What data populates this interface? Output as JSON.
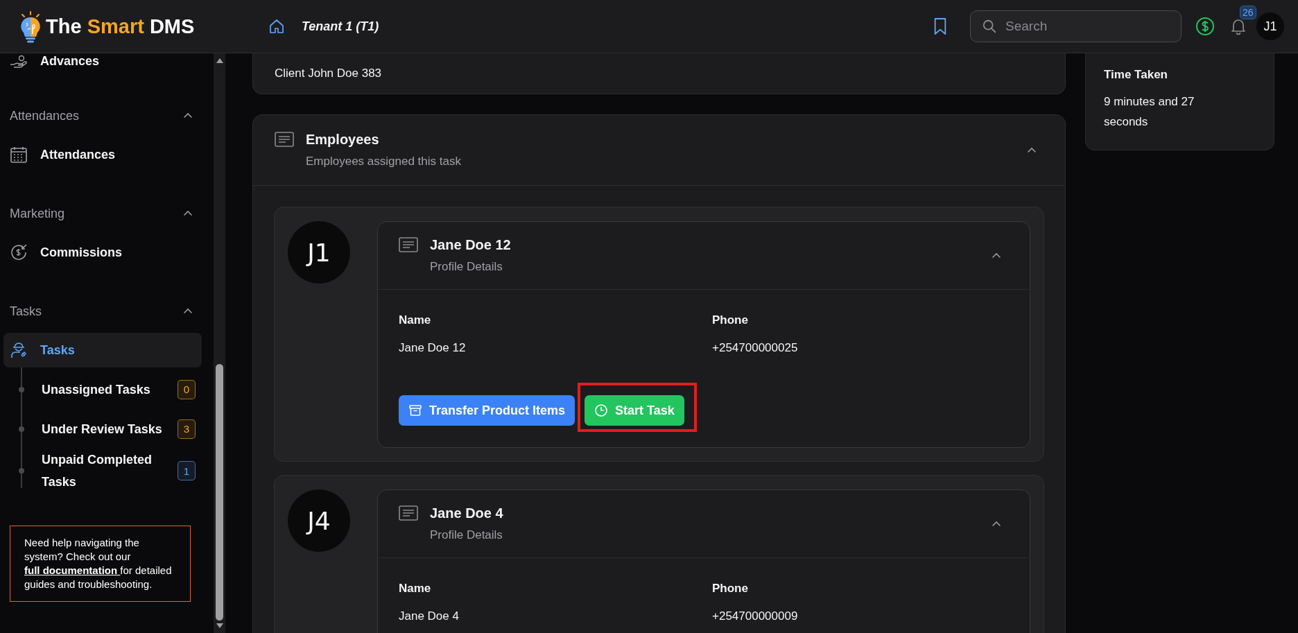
{
  "header": {
    "logo": [
      {
        "text": "The",
        "accent": false
      },
      {
        "text": "Smart",
        "accent": true
      },
      {
        "text": "DMS",
        "accent": false
      }
    ],
    "tenant": "Tenant 1 (T1)",
    "search": {
      "placeholder": "Search"
    },
    "notification_count": "26",
    "avatar": "J1"
  },
  "sidebar": {
    "top_item": {
      "label": "Advances"
    },
    "sections": [
      {
        "title": "Attendances",
        "expanded": true,
        "items": [
          {
            "label": "Attendances",
            "selected": false
          }
        ]
      },
      {
        "title": "Marketing",
        "expanded": true,
        "items": [
          {
            "label": "Commissions",
            "selected": false
          }
        ]
      },
      {
        "title": "Tasks",
        "expanded": true,
        "items": [
          {
            "label": "Tasks",
            "selected": true,
            "children": [
              {
                "label": "Unassigned Tasks",
                "count": "0",
                "color": "#f5a524"
              },
              {
                "label": "Under Review Tasks",
                "count": "3",
                "color": "#f5a524"
              },
              {
                "label": "Unpaid Completed Tasks",
                "count": "1",
                "color": "#60a5fa"
              }
            ]
          }
        ]
      }
    ],
    "help": {
      "before": "Need help navigating the system? Check out our ",
      "link": "full documentation ",
      "after": "for detailed guides and troubleshooting."
    }
  },
  "client_card": {
    "text": "Client John Doe 383"
  },
  "employees": {
    "title": "Employees",
    "subtitle": "Employees assigned this task",
    "expanded": true,
    "members": [
      {
        "initials": "J1",
        "name": "Jane Doe 12",
        "subtitle": "Profile Details",
        "expanded": true,
        "fields": [
          {
            "label": "Name",
            "value": "Jane Doe 12"
          },
          {
            "label": "Phone",
            "value": "+254700000025"
          }
        ],
        "actions": [
          {
            "kind": "transfer",
            "label": "Transfer Product Items",
            "highlighted": false
          },
          {
            "kind": "start",
            "label": "Start Task",
            "highlighted": true
          }
        ]
      },
      {
        "initials": "J4",
        "name": "Jane Doe 4",
        "subtitle": "Profile Details",
        "expanded": true,
        "fields": [
          {
            "label": "Name",
            "value": "Jane Doe 4"
          },
          {
            "label": "Phone",
            "value": "+254700000009"
          }
        ]
      }
    ]
  },
  "side_card": {
    "title": "Time Taken",
    "value": "9 minutes and 27 seconds"
  }
}
